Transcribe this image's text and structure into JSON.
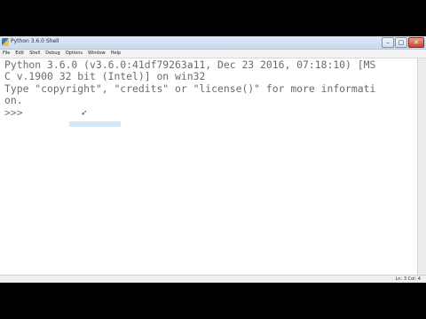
{
  "window": {
    "title": "Python 3.6.0 Shell",
    "minimize_glyph": "–",
    "maximize_glyph": "□",
    "close_glyph": "✕"
  },
  "menu": [
    "File",
    "Edit",
    "Shell",
    "Debug",
    "Options",
    "Window",
    "Help"
  ],
  "shell": {
    "line1": "Python 3.6.0 (v3.6.0:41df79263a11, Dec 23 2016, 07:18:10) [MS",
    "line2": "C v.1900 32 bit (Intel)] on win32",
    "line3": "Type \"copyright\", \"credits\" or \"license()\" for more informati",
    "line4": "on.",
    "prompt": ">>> "
  },
  "status": {
    "position": "Ln: 3   Col: 4"
  },
  "colors": {
    "output_text": "#6b6b6b",
    "prompt_text": "#8b6f6f",
    "selection": "#cfe3f5"
  },
  "icons": [
    "python-app-icon",
    "mouse-cursor-icon"
  ]
}
